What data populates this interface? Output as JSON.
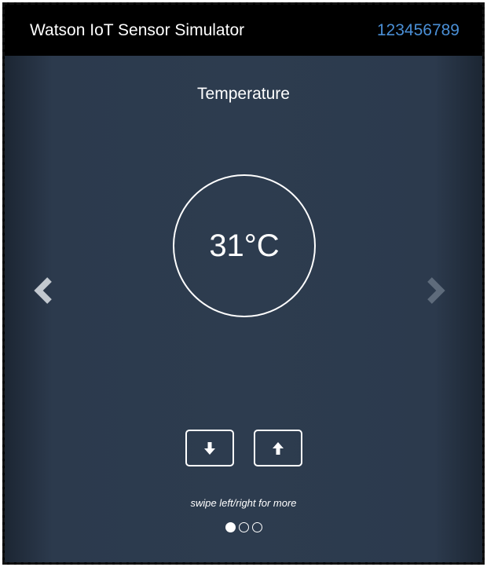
{
  "header": {
    "title": "Watson IoT Sensor Simulator",
    "device_id": "123456789"
  },
  "sensor": {
    "name": "Temperature",
    "value": "31°C"
  },
  "navigation": {
    "prev_icon": "chevron-left-icon",
    "next_icon": "chevron-right-icon"
  },
  "controls": {
    "decrease_icon": "arrow-down-icon",
    "increase_icon": "arrow-up-icon"
  },
  "hint": "swipe left/right for more",
  "pagination": {
    "total": 3,
    "active_index": 0
  },
  "colors": {
    "header_bg": "#000000",
    "device_id": "#4a8fd6",
    "stage_bg": "#2d3c4f",
    "prev_arrow": "#c2c8cf",
    "next_arrow": "#5e6b7b"
  }
}
